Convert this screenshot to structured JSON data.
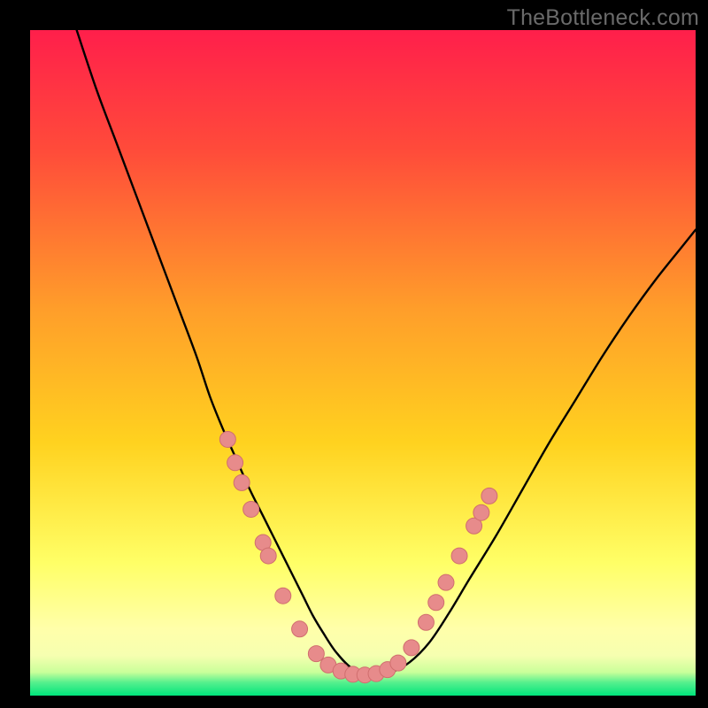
{
  "watermark": "TheBottleneck.com",
  "colors": {
    "gradient_top": "#ff1f4b",
    "gradient_mid1": "#ff7a2a",
    "gradient_mid2": "#ffd21f",
    "gradient_mid3": "#ffff66",
    "gradient_band": "#ffffaa",
    "gradient_green": "#00e57b",
    "curve": "#000000",
    "dot_fill": "#e78b8b",
    "dot_stroke": "#d06e6e"
  },
  "chart_data": {
    "type": "line",
    "title": "",
    "xlabel": "",
    "ylabel": "",
    "xlim": [
      0,
      100
    ],
    "ylim": [
      0,
      100
    ],
    "series": [
      {
        "name": "bottleneck-curve",
        "x": [
          7,
          10,
          13,
          16,
          19,
          22,
          25,
          27,
          29,
          31,
          33,
          35,
          36.5,
          38,
          39.5,
          41,
          42.5,
          44,
          46,
          48.5,
          51.5,
          54,
          57,
          60,
          63,
          66,
          70,
          74,
          78,
          82,
          86,
          90,
          94,
          98,
          100
        ],
        "y": [
          100,
          91,
          83,
          75,
          67,
          59,
          51,
          45,
          40,
          35.5,
          31,
          27,
          24,
          21,
          18,
          15,
          12,
          9.5,
          6.5,
          4,
          3,
          3.4,
          5,
          8,
          12.5,
          17.5,
          24,
          31,
          38,
          44.5,
          51,
          57,
          62.5,
          67.5,
          70
        ]
      }
    ],
    "points": [
      {
        "x": 29.7,
        "y": 38.5
      },
      {
        "x": 30.8,
        "y": 35
      },
      {
        "x": 31.8,
        "y": 32
      },
      {
        "x": 33.2,
        "y": 28
      },
      {
        "x": 35.0,
        "y": 23
      },
      {
        "x": 35.8,
        "y": 21
      },
      {
        "x": 38.0,
        "y": 15
      },
      {
        "x": 40.5,
        "y": 10
      },
      {
        "x": 43.0,
        "y": 6.3
      },
      {
        "x": 44.8,
        "y": 4.6
      },
      {
        "x": 46.7,
        "y": 3.7
      },
      {
        "x": 48.5,
        "y": 3.2
      },
      {
        "x": 50.3,
        "y": 3.1
      },
      {
        "x": 52.0,
        "y": 3.3
      },
      {
        "x": 53.7,
        "y": 3.9
      },
      {
        "x": 55.3,
        "y": 4.9
      },
      {
        "x": 57.3,
        "y": 7.2
      },
      {
        "x": 59.5,
        "y": 11
      },
      {
        "x": 61.0,
        "y": 14
      },
      {
        "x": 62.5,
        "y": 17
      },
      {
        "x": 64.5,
        "y": 21
      },
      {
        "x": 66.7,
        "y": 25.5
      },
      {
        "x": 67.8,
        "y": 27.5
      },
      {
        "x": 69.0,
        "y": 30
      }
    ]
  }
}
